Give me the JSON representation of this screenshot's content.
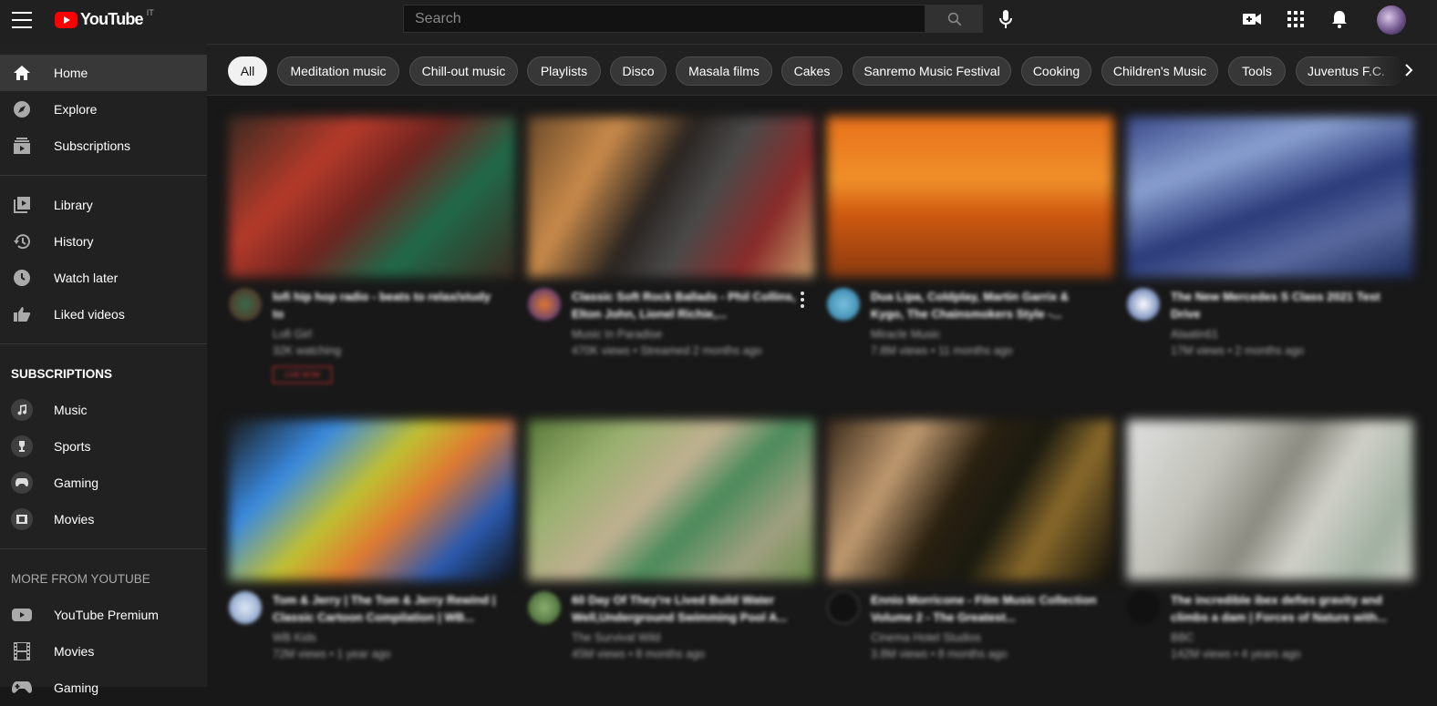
{
  "topbar": {
    "logo_text": "YouTube",
    "region": "IT",
    "search_placeholder": "Search"
  },
  "sidebar": {
    "main": [
      {
        "label": "Home",
        "icon": "home-icon",
        "active": true
      },
      {
        "label": "Explore",
        "icon": "compass-icon"
      },
      {
        "label": "Subscriptions",
        "icon": "subscriptions-icon"
      }
    ],
    "library": [
      {
        "label": "Library",
        "icon": "library-icon"
      },
      {
        "label": "History",
        "icon": "history-icon"
      },
      {
        "label": "Watch later",
        "icon": "clock-icon"
      },
      {
        "label": "Liked videos",
        "icon": "thumbs-up-icon"
      }
    ],
    "subscriptions_heading": "SUBSCRIPTIONS",
    "subscriptions": [
      {
        "label": "Music",
        "icon": "music-icon"
      },
      {
        "label": "Sports",
        "icon": "trophy-icon"
      },
      {
        "label": "Gaming",
        "icon": "gamepad-icon"
      },
      {
        "label": "Movies",
        "icon": "film-icon"
      }
    ],
    "more_heading": "MORE FROM YOUTUBE",
    "more": [
      {
        "label": "YouTube Premium",
        "icon": "youtube-icon"
      },
      {
        "label": "Movies",
        "icon": "film-strip-icon"
      },
      {
        "label": "Gaming",
        "icon": "gamepad-icon"
      }
    ]
  },
  "chips": [
    "All",
    "Meditation music",
    "Chill-out music",
    "Playlists",
    "Disco",
    "Masala films",
    "Cakes",
    "Sanremo Music Festival",
    "Cooking",
    "Children's Music",
    "Tools",
    "Juventus F.C."
  ],
  "videos": [
    {
      "title": "lofi hip hop radio - beats to relax/study to",
      "channel": "Lofi Girl",
      "stats": "32K watching",
      "badge": "LIVE NOW"
    },
    {
      "title": "Classic Soft Rock Ballads - Phil Collins, Elton John, Lionel Richie,...",
      "channel": "Music In Paradise",
      "stats": "470K views • Streamed 2 months ago"
    },
    {
      "title": "Dua Lipa, Coldplay, Martin Garrix & Kygo, The Chainsmokers Style -...",
      "channel": "Miracle Music",
      "stats": "7.8M views • 11 months ago"
    },
    {
      "title": "The New Mercedes S Class 2021 Test Drive",
      "channel": "Alaatin61",
      "stats": "17M views • 2 months ago"
    },
    {
      "title": "Tom & Jerry | The Tom & Jerry Rewind | Classic Cartoon Compilation | WB...",
      "channel": "WB Kids",
      "stats": "72M views • 1 year ago"
    },
    {
      "title": "60 Day Of They're Lived Build Water Well,Underground Swimming Pool A...",
      "channel": "The Survival Wild",
      "stats": "45M views • 8 months ago"
    },
    {
      "title": "Ennio Morricone - Film Music Collection Volume 2 - The Greatest...",
      "channel": "Cinema Hotel Studios",
      "stats": "3.8M views • 8 months ago"
    },
    {
      "title": "The incredible ibex defies gravity and climbs a dam | Forces of Nature with...",
      "channel": "BBC",
      "stats": "142M views • 4 years ago"
    }
  ]
}
